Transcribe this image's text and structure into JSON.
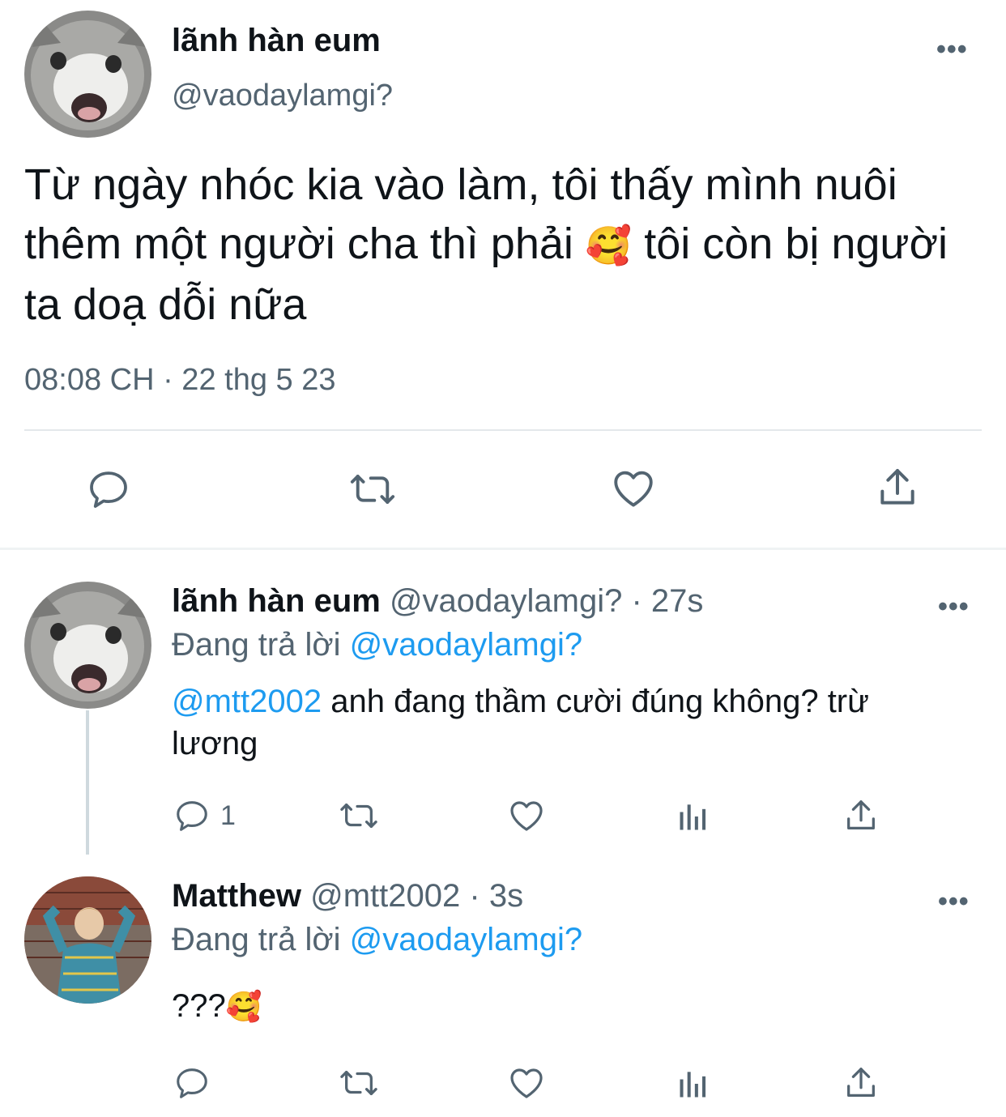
{
  "main_tweet": {
    "author_name": "lãnh hàn eum",
    "author_handle": "@vaodaylamgi?",
    "text_line1": "Từ ngày nhóc kia vào làm, tôi thấy mình nuôi",
    "text_line2a": "thêm một người cha thì phải",
    "text_emoji": "🥰",
    "text_line2b": "tôi còn bị người",
    "text_line3": "ta doạ dỗi nữa",
    "timestamp": "08:08 CH · 22 thg 5 23",
    "more_label": "•••",
    "actions": [
      "reply-icon",
      "retweet-icon",
      "like-icon",
      "share-icon"
    ]
  },
  "replies": [
    {
      "author_name": "lãnh hàn eum",
      "author_handle": "@vaodaylamgi?",
      "time_ago": "· 27s",
      "replying_prefix": "Đang trả lời",
      "replying_to": "@vaodaylamgi?",
      "mention": "@mtt2002",
      "text_line1": " anh đang thầm cười đúng không? trừ",
      "text_line2": "lương",
      "reply_count": "1",
      "more_label": "•••"
    },
    {
      "author_name": "Matthew",
      "author_handle": "@mtt2002",
      "time_ago": "· 3s",
      "replying_prefix": "Đang trả lời",
      "replying_to": "@vaodaylamgi?",
      "text": "???",
      "text_emoji": "🥰",
      "more_label": "•••"
    }
  ],
  "colors": {
    "text": "#0f1419",
    "secondary": "#536471",
    "link": "#1d9bf0",
    "divider": "#e4e8eb"
  }
}
